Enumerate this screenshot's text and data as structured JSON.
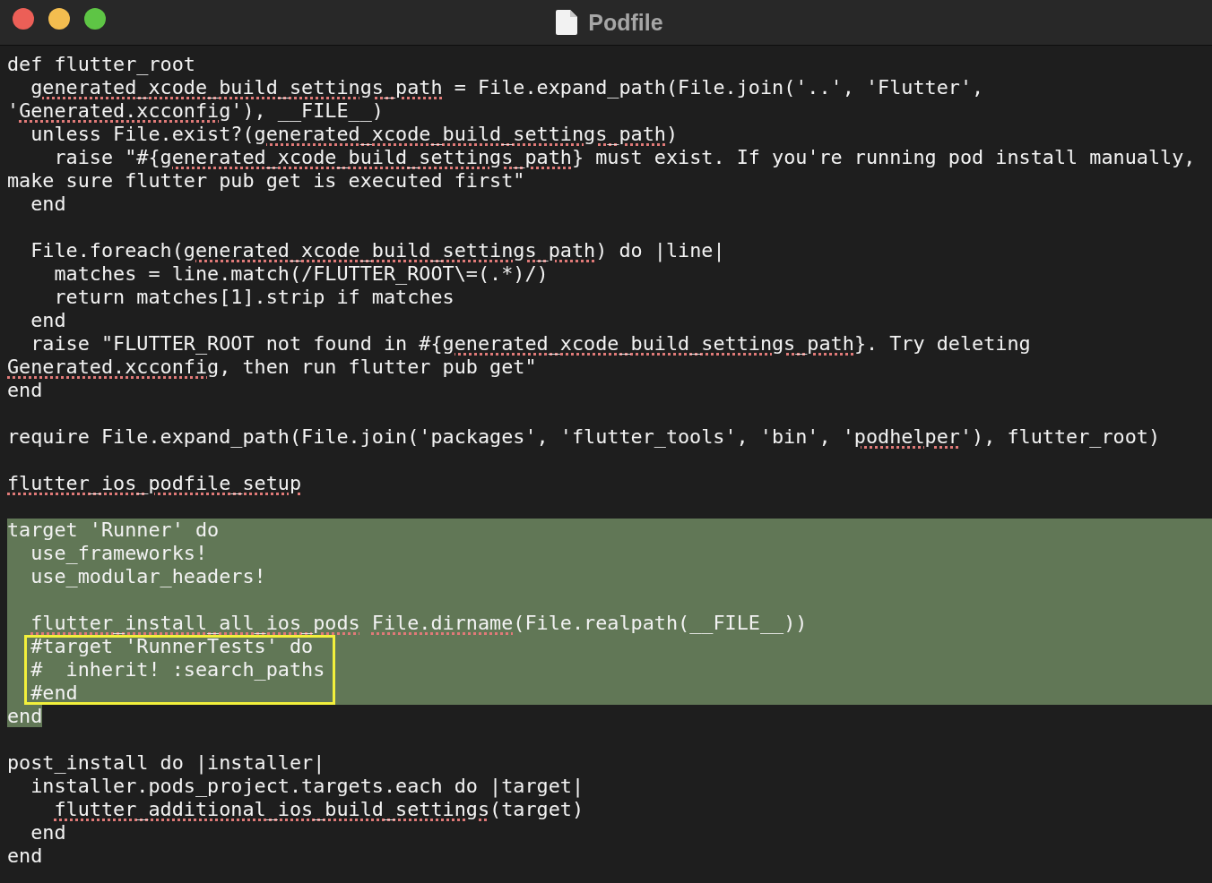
{
  "window": {
    "title": "Podfile"
  },
  "lines": [
    {
      "kind": "code",
      "segments": [
        {
          "text": "def flutter_root",
          "misspelled": false
        }
      ]
    },
    {
      "kind": "code",
      "segments": [
        {
          "text": "  generated_xcode_build_settings_path",
          "misspelled": true
        },
        {
          "text": " = File.expand_path(File.join('..', 'Flutter',",
          "misspelled": false
        }
      ]
    },
    {
      "kind": "code",
      "segments": [
        {
          "text": "'",
          "misspelled": false
        },
        {
          "text": "Generated.xcconfig",
          "misspelled": true
        },
        {
          "text": "'), __FILE__)",
          "misspelled": false
        }
      ]
    },
    {
      "kind": "code",
      "segments": [
        {
          "text": "  unless File.exist?(",
          "misspelled": false
        },
        {
          "text": "generated_xcode_build_settings_path",
          "misspelled": true
        },
        {
          "text": ")",
          "misspelled": false
        }
      ]
    },
    {
      "kind": "code",
      "segments": [
        {
          "text": "    raise \"#{",
          "misspelled": false
        },
        {
          "text": "generated_xcode_build_settings_path",
          "misspelled": true
        },
        {
          "text": "} must exist. If you're running pod install manually,",
          "misspelled": false
        }
      ]
    },
    {
      "kind": "code",
      "segments": [
        {
          "text": "make sure flutter pub get is executed first\"",
          "misspelled": false
        }
      ]
    },
    {
      "kind": "code",
      "segments": [
        {
          "text": "  end",
          "misspelled": false
        }
      ]
    },
    {
      "kind": "blank"
    },
    {
      "kind": "code",
      "segments": [
        {
          "text": "  File.foreach(",
          "misspelled": false
        },
        {
          "text": "generated_xcode_build_settings_path",
          "misspelled": true
        },
        {
          "text": ") do |line|",
          "misspelled": false
        }
      ]
    },
    {
      "kind": "code",
      "segments": [
        {
          "text": "    matches = line.match(/FLUTTER_ROOT\\=(.*)/)",
          "misspelled": false
        }
      ]
    },
    {
      "kind": "code",
      "segments": [
        {
          "text": "    return matches[1].strip if matches",
          "misspelled": false
        }
      ]
    },
    {
      "kind": "code",
      "segments": [
        {
          "text": "  end",
          "misspelled": false
        }
      ]
    },
    {
      "kind": "code",
      "segments": [
        {
          "text": "  raise \"FLUTTER_ROOT not found in #{",
          "misspelled": false
        },
        {
          "text": "generated_xcode_build_settings_path",
          "misspelled": true
        },
        {
          "text": "}. Try deleting",
          "misspelled": false
        }
      ]
    },
    {
      "kind": "code",
      "segments": [
        {
          "text": "Generated.xcconfig",
          "misspelled": true
        },
        {
          "text": ", then run flutter pub get\"",
          "misspelled": false
        }
      ]
    },
    {
      "kind": "code",
      "segments": [
        {
          "text": "end",
          "misspelled": false
        }
      ]
    },
    {
      "kind": "blank"
    },
    {
      "kind": "code",
      "segments": [
        {
          "text": "require File.expand_path(File.join('packages', 'flutter_tools', 'bin', '",
          "misspelled": false
        },
        {
          "text": "podhelper",
          "misspelled": true
        },
        {
          "text": "'), flutter_root)",
          "misspelled": false
        }
      ]
    },
    {
      "kind": "blank"
    },
    {
      "kind": "code",
      "segments": [
        {
          "text": "flutter_ios_podfile_setup",
          "misspelled": true
        }
      ]
    },
    {
      "kind": "blank"
    },
    {
      "kind": "selection",
      "lines": [
        {
          "kind": "code",
          "segments": [
            {
              "text": "target 'Runner' do",
              "misspelled": false
            }
          ]
        },
        {
          "kind": "code",
          "segments": [
            {
              "text": "  use_frameworks!",
              "misspelled": false
            }
          ]
        },
        {
          "kind": "code",
          "segments": [
            {
              "text": "  use_modular_headers!",
              "misspelled": false
            }
          ]
        },
        {
          "kind": "blank"
        },
        {
          "kind": "code",
          "segments": [
            {
              "text": "  flutter_install_all_ios_pods",
              "misspelled": true
            },
            {
              "text": " File.dirname",
              "misspelled": true
            },
            {
              "text": "(File.realpath(__FILE__))",
              "misspelled": false
            }
          ]
        },
        {
          "kind": "annotation",
          "lines": [
            {
              "kind": "code",
              "segments": [
                {
                  "text": "  #target 'RunnerTests' do",
                  "misspelled": false
                }
              ]
            },
            {
              "kind": "code",
              "segments": [
                {
                  "text": "  #  inherit! :search_paths",
                  "misspelled": false
                }
              ]
            },
            {
              "kind": "code",
              "segments": [
                {
                  "text": "  #end",
                  "misspelled": false
                }
              ]
            }
          ]
        },
        {
          "kind": "code",
          "segments": [
            {
              "text": "end",
              "misspelled": false
            }
          ]
        }
      ]
    },
    {
      "kind": "blank"
    },
    {
      "kind": "code",
      "segments": [
        {
          "text": "post_install do |installer|",
          "misspelled": false
        }
      ]
    },
    {
      "kind": "code",
      "segments": [
        {
          "text": "  installer.pods_project.targets.each do |target|",
          "misspelled": false
        }
      ]
    },
    {
      "kind": "code",
      "segments": [
        {
          "text": "    flutter_additional_ios_build_settings",
          "misspelled": true
        },
        {
          "text": "(target)",
          "misspelled": false
        }
      ]
    },
    {
      "kind": "code",
      "segments": [
        {
          "text": "  end",
          "misspelled": false
        }
      ]
    },
    {
      "kind": "code",
      "segments": [
        {
          "text": "end",
          "misspelled": false
        }
      ]
    }
  ]
}
